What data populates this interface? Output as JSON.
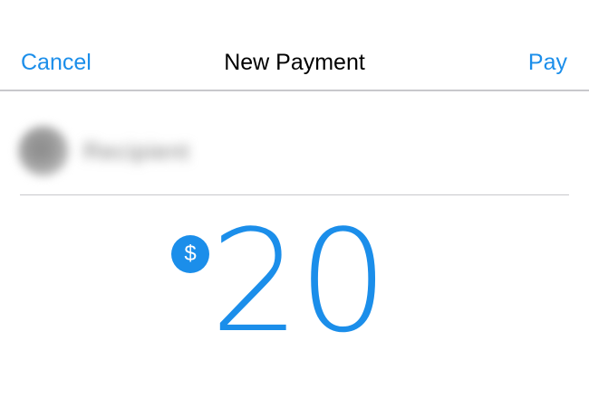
{
  "nav": {
    "cancel_label": "Cancel",
    "title": "New Payment",
    "pay_label": "Pay"
  },
  "recipient": {
    "name": "Recipient"
  },
  "amount": {
    "currency_symbol": "$",
    "value": "20"
  },
  "colors": {
    "accent": "#1b8eea",
    "divider": "#c8c8cc",
    "title_text": "#000000"
  }
}
